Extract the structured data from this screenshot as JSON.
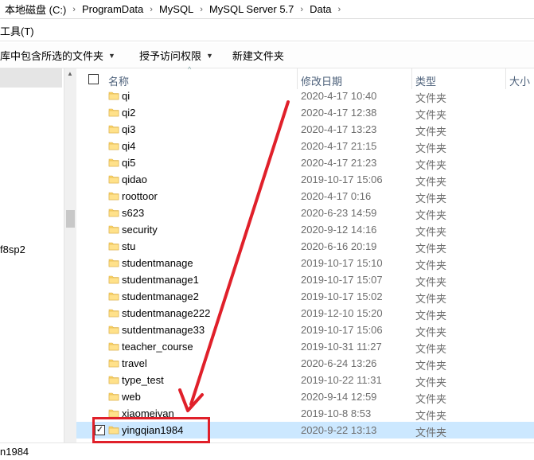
{
  "breadcrumb": [
    {
      "label": "本地磁盘 (C:)"
    },
    {
      "label": "ProgramData"
    },
    {
      "label": "MySQL"
    },
    {
      "label": "MySQL Server 5.7"
    },
    {
      "label": "Data"
    }
  ],
  "menubar": {
    "tools": "工具(T)"
  },
  "toolbar": {
    "include_library": "库中包含所选的文件夹",
    "grant_access": "授予访问权限",
    "new_folder": "新建文件夹"
  },
  "navpane": {
    "partial_label": "f8sp2"
  },
  "columns": {
    "name": "名称",
    "date": "修改日期",
    "type": "类型",
    "size": "大小"
  },
  "files": [
    {
      "name": "qi",
      "date": "2020-4-17 10:40",
      "type": "文件夹"
    },
    {
      "name": "qi2",
      "date": "2020-4-17 12:38",
      "type": "文件夹"
    },
    {
      "name": "qi3",
      "date": "2020-4-17 13:23",
      "type": "文件夹"
    },
    {
      "name": "qi4",
      "date": "2020-4-17 21:15",
      "type": "文件夹"
    },
    {
      "name": "qi5",
      "date": "2020-4-17 21:23",
      "type": "文件夹"
    },
    {
      "name": "qidao",
      "date": "2019-10-17 15:06",
      "type": "文件夹"
    },
    {
      "name": "roottoor",
      "date": "2020-4-17 0:16",
      "type": "文件夹"
    },
    {
      "name": "s623",
      "date": "2020-6-23 14:59",
      "type": "文件夹"
    },
    {
      "name": "security",
      "date": "2020-9-12 14:16",
      "type": "文件夹"
    },
    {
      "name": "stu",
      "date": "2020-6-16 20:19",
      "type": "文件夹"
    },
    {
      "name": "studentmanage",
      "date": "2019-10-17 15:10",
      "type": "文件夹"
    },
    {
      "name": "studentmanage1",
      "date": "2019-10-17 15:07",
      "type": "文件夹"
    },
    {
      "name": "studentmanage2",
      "date": "2019-10-17 15:02",
      "type": "文件夹"
    },
    {
      "name": "studentmanage222",
      "date": "2019-12-10 15:20",
      "type": "文件夹"
    },
    {
      "name": "sutdentmanage33",
      "date": "2019-10-17 15:06",
      "type": "文件夹"
    },
    {
      "name": "teacher_course",
      "date": "2019-10-31 11:27",
      "type": "文件夹"
    },
    {
      "name": "travel",
      "date": "2020-6-24 13:26",
      "type": "文件夹"
    },
    {
      "name": "type_test",
      "date": "2019-10-22 11:31",
      "type": "文件夹"
    },
    {
      "name": "web",
      "date": "2020-9-14 12:59",
      "type": "文件夹"
    },
    {
      "name": "xiaomeiyan",
      "date": "2019-10-8 8:53",
      "type": "文件夹"
    },
    {
      "name": "yingqian1984",
      "date": "2020-9-22 13:13",
      "type": "文件夹",
      "selected": true
    }
  ],
  "statusbar": {
    "text": "n1984"
  },
  "colors": {
    "selection": "#cce8ff",
    "annotation": "#e0202a",
    "folder": "#ffd764"
  }
}
